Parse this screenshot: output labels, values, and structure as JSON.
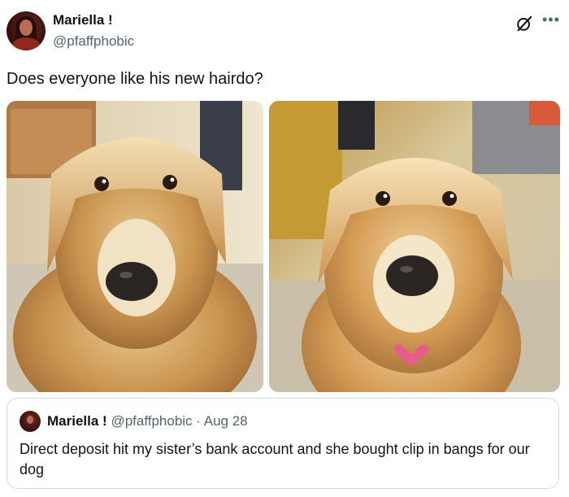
{
  "tweet": {
    "author": {
      "name": "Mariella !",
      "handle": "@pfaffphobic"
    },
    "more_icon": "more-horizontal-icon",
    "grok_icon": "grok-icon",
    "text": "Does everyone like his new hairdo?",
    "media": [
      {
        "description": "golden retriever dog wearing clip-in bangs, lying on carpet"
      },
      {
        "description": "golden retriever dog wearing clip-in bangs, sitting with pink heart tag"
      }
    ]
  },
  "quoted_tweet": {
    "name": "Mariella !",
    "handle": "@pfaffphobic",
    "separator": " · ",
    "date": "Aug 28",
    "text": "Direct deposit hit my sister’s bank account and she bought clip in bangs for our dog"
  },
  "colors": {
    "text_primary": "#0f1419",
    "text_secondary": "#536471",
    "border": "#cfd9de"
  }
}
